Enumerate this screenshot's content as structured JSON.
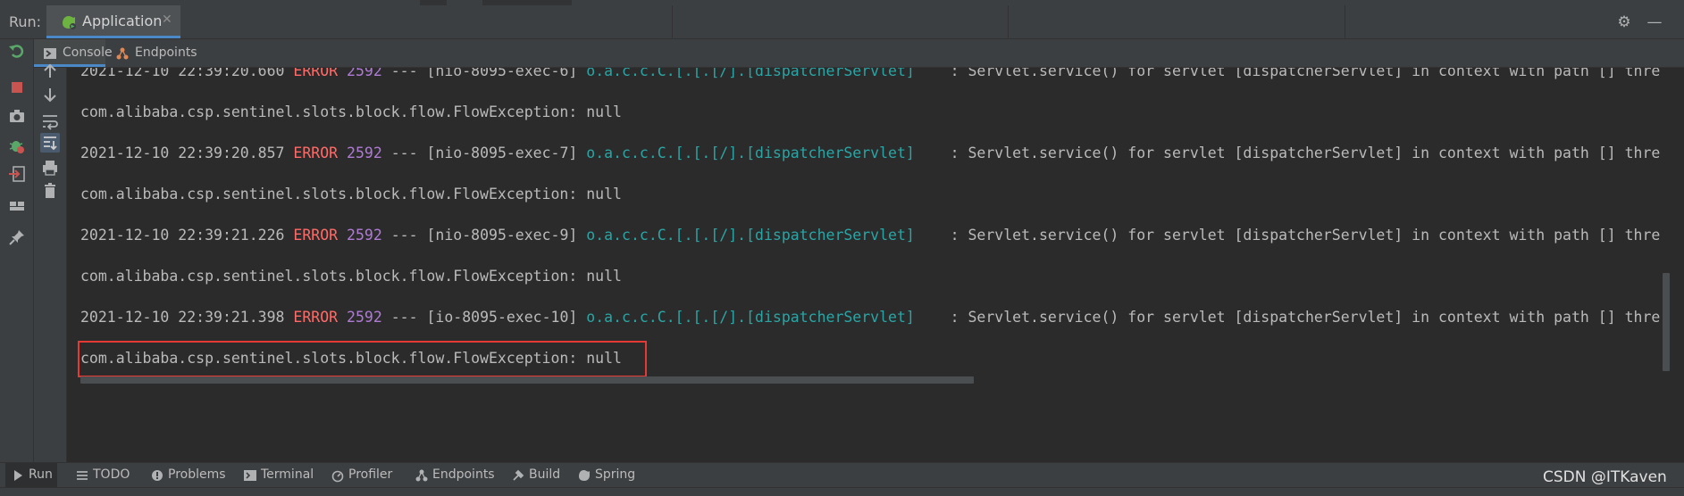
{
  "header": {
    "run_label": "Run:",
    "tab_label": "Application",
    "close_glyph": "✕",
    "gear_glyph": "⚙",
    "minimize_glyph": "—"
  },
  "console_tabs": [
    {
      "label": "Console",
      "icon": "console-icon"
    },
    {
      "label": "Endpoints",
      "icon": "endpoints-icon"
    }
  ],
  "log_lines": [
    {
      "date": "2021-12-10 22:39:20.660",
      "level": "ERROR",
      "pid": "2592",
      "sep": "---",
      "thread": "[nio-8095-exec-6]",
      "logger": "o.a.c.c.C.[.[.[/].[dispatcherServlet]",
      "message": ": Servlet.service() for servlet [dispatcherServlet] in context with path [] thre"
    },
    {
      "exception": "com.alibaba.csp.sentinel.slots.block.flow.FlowException: null"
    },
    {
      "date": "2021-12-10 22:39:20.857",
      "level": "ERROR",
      "pid": "2592",
      "sep": "---",
      "thread": "[nio-8095-exec-7]",
      "logger": "o.a.c.c.C.[.[.[/].[dispatcherServlet]",
      "message": ": Servlet.service() for servlet [dispatcherServlet] in context with path [] thre"
    },
    {
      "exception": "com.alibaba.csp.sentinel.slots.block.flow.FlowException: null"
    },
    {
      "date": "2021-12-10 22:39:21.226",
      "level": "ERROR",
      "pid": "2592",
      "sep": "---",
      "thread": "[nio-8095-exec-9]",
      "logger": "o.a.c.c.C.[.[.[/].[dispatcherServlet]",
      "message": ": Servlet.service() for servlet [dispatcherServlet] in context with path [] thre"
    },
    {
      "exception": "com.alibaba.csp.sentinel.slots.block.flow.FlowException: null"
    },
    {
      "date": "2021-12-10 22:39:21.398",
      "level": "ERROR",
      "pid": "2592",
      "sep": "---",
      "thread": "[io-8095-exec-10]",
      "logger": "o.a.c.c.C.[.[.[/].[dispatcherServlet]",
      "message": ": Servlet.service() for servlet [dispatcherServlet] in context with path [] thre"
    },
    {
      "exception": "com.alibaba.csp.sentinel.slots.block.flow.FlowException: null"
    }
  ],
  "left_toolbar_icons": [
    "rerun-icon",
    "stop-icon",
    "screenshot-icon",
    "debug-icon",
    "exit-icon",
    "layout-icon",
    "pin-icon"
  ],
  "side_toolbar_icons": [
    "up-arrow-icon",
    "down-arrow-icon",
    "soft-wrap-icon",
    "scroll-to-end-icon",
    "print-icon",
    "trash-icon"
  ],
  "bottom_tabs": [
    {
      "label": "Run",
      "icon": "run-icon"
    },
    {
      "label": "TODO",
      "icon": "todo-icon"
    },
    {
      "label": "Problems",
      "icon": "problems-icon"
    },
    {
      "label": "Terminal",
      "icon": "terminal-icon"
    },
    {
      "label": "Profiler",
      "icon": "profiler-icon"
    },
    {
      "label": "Endpoints",
      "icon": "endpoints-icon"
    },
    {
      "label": "Build",
      "icon": "build-icon"
    },
    {
      "label": "Spring",
      "icon": "spring-icon"
    }
  ],
  "watermark": "CSDN @ITKaven",
  "colors": {
    "error": "#ff6b68",
    "pid": "#b07bd6",
    "logger": "#2aa5a5",
    "highlight_border": "#e53935",
    "accent": "#4a88c7",
    "background": "#2b2b2b"
  }
}
